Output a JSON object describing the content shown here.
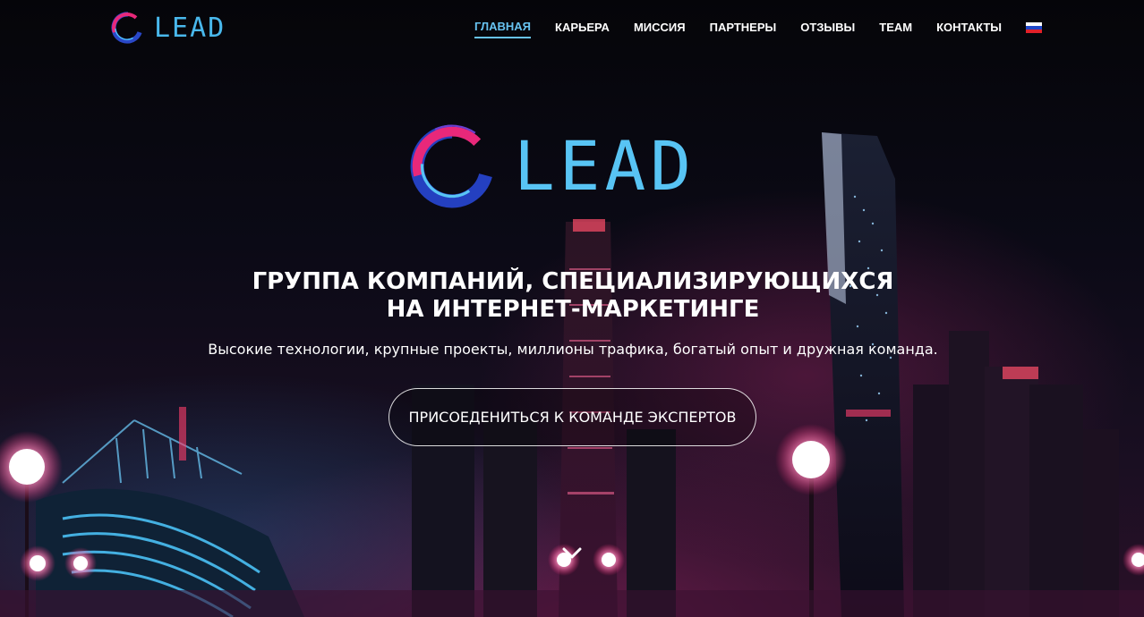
{
  "header": {
    "logo_text": "LEAD",
    "nav": [
      {
        "label": "ГЛАВНАЯ",
        "active": true
      },
      {
        "label": "КАРЬЕРА",
        "active": false
      },
      {
        "label": "МИССИЯ",
        "active": false
      },
      {
        "label": "ПАРТНЕРЫ",
        "active": false
      },
      {
        "label": "ОТЗЫВЫ",
        "active": false
      },
      {
        "label": "TEAM",
        "active": false
      },
      {
        "label": "КОНТАКТЫ",
        "active": false
      }
    ],
    "language_icon": "russian-flag-icon"
  },
  "hero": {
    "logo_text": "LEAD",
    "headline_line1": "ГРУППА КОМПАНИЙ, СПЕЦИАЛИЗИРУЮЩИХСЯ",
    "headline_line2": "НА ИНТЕРНЕТ-МАРКЕТИНГЕ",
    "subline": "Высокие технологии, крупные проекты, миллионы трафика, богатый опыт и дружная команда.",
    "cta_label": "ПРИСОЕДЕНИТЬСЯ К КОМАНДЕ ЭКСПЕРТОВ",
    "scroll_icon": "chevron-down-icon"
  },
  "colors": {
    "accent_blue": "#58c4f4",
    "accent_pink": "#e8287a",
    "nav_active": "#67c3f0",
    "background": "#07060d"
  }
}
